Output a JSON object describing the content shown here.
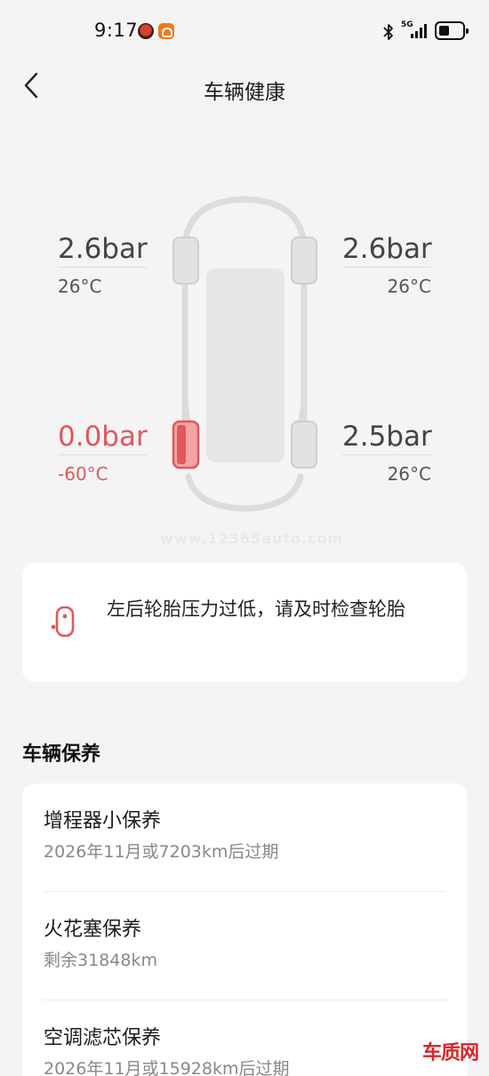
{
  "status_bar": {
    "time": "9:17",
    "network": "5G"
  },
  "header": {
    "title": "车辆健康"
  },
  "tires": {
    "front_left": {
      "pressure": "2.6bar",
      "temp": "26°C",
      "alert": false
    },
    "front_right": {
      "pressure": "2.6bar",
      "temp": "26°C",
      "alert": false
    },
    "rear_left": {
      "pressure": "0.0bar",
      "temp": "-60°C",
      "alert": true
    },
    "rear_right": {
      "pressure": "2.5bar",
      "temp": "26°C",
      "alert": false
    }
  },
  "watermark": "www.12365auto.com",
  "alert": {
    "message": "左后轮胎压力过低，请及时检查轮胎"
  },
  "maintenance": {
    "title": "车辆保养",
    "items": [
      {
        "name": "增程器小保养",
        "detail": "2026年11月或7203km后过期"
      },
      {
        "name": "火花塞保养",
        "detail": "剩余31848km"
      },
      {
        "name": "空调滤芯保养",
        "detail": "2026年11月或15928km后过期"
      }
    ]
  },
  "colors": {
    "alert_red": "#e0585a",
    "background": "#f4f4f4",
    "card": "#ffffff"
  },
  "corner_logo": "车质网"
}
